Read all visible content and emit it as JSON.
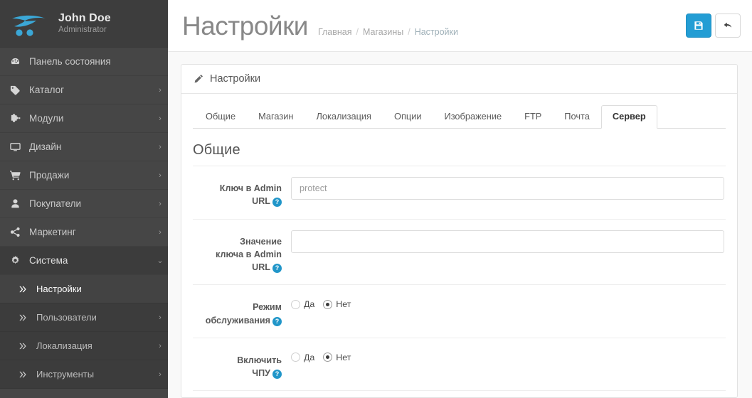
{
  "sidebar": {
    "brand": {
      "name": "John Doe",
      "role": "Administrator",
      "logo_icon": "opencart-logo-icon"
    },
    "items": [
      {
        "label": "Панель состояния",
        "icon": "dashboard-icon",
        "caret": "",
        "level": 0,
        "state": ""
      },
      {
        "label": "Каталог",
        "icon": "tag-icon",
        "caret": "›",
        "level": 0,
        "state": ""
      },
      {
        "label": "Модули",
        "icon": "puzzle-icon",
        "caret": "›",
        "level": 0,
        "state": ""
      },
      {
        "label": "Дизайн",
        "icon": "monitor-icon",
        "caret": "›",
        "level": 0,
        "state": ""
      },
      {
        "label": "Продажи",
        "icon": "cart-icon",
        "caret": "›",
        "level": 0,
        "state": ""
      },
      {
        "label": "Покупатели",
        "icon": "user-icon",
        "caret": "›",
        "level": 0,
        "state": ""
      },
      {
        "label": "Маркетинг",
        "icon": "share-icon",
        "caret": "›",
        "level": 0,
        "state": ""
      },
      {
        "label": "Система",
        "icon": "gear-icon",
        "caret": "⌄",
        "level": 0,
        "state": "open"
      },
      {
        "label": "Настройки",
        "icon": "chevron-double-right-icon",
        "caret": "",
        "level": 1,
        "state": "active"
      },
      {
        "label": "Пользователи",
        "icon": "chevron-double-right-icon",
        "caret": "›",
        "level": 1,
        "state": ""
      },
      {
        "label": "Локализация",
        "icon": "chevron-double-right-icon",
        "caret": "›",
        "level": 1,
        "state": ""
      },
      {
        "label": "Инструменты",
        "icon": "chevron-double-right-icon",
        "caret": "›",
        "level": 1,
        "state": ""
      }
    ]
  },
  "header": {
    "title": "Настройки",
    "breadcrumb": [
      {
        "label": "Главная",
        "last": false
      },
      {
        "label": "Магазины",
        "last": false
      },
      {
        "label": "Настройки",
        "last": true
      }
    ],
    "separator": "/",
    "actions": [
      {
        "name": "save-button",
        "icon": "floppy-save-icon",
        "style": "primary"
      },
      {
        "name": "back-button",
        "icon": "back-arrow-icon",
        "style": "default"
      }
    ]
  },
  "panel": {
    "heading": "Настройки",
    "heading_icon": "pencil-icon",
    "tabs": [
      {
        "label": "Общие",
        "active": false
      },
      {
        "label": "Магазин",
        "active": false
      },
      {
        "label": "Локализация",
        "active": false
      },
      {
        "label": "Опции",
        "active": false
      },
      {
        "label": "Изображение",
        "active": false
      },
      {
        "label": "FTP",
        "active": false
      },
      {
        "label": "Почта",
        "active": false
      },
      {
        "label": "Сервер",
        "active": true
      }
    ],
    "section_title": "Общие",
    "help_glyph": "?",
    "fields": [
      {
        "type": "text",
        "label_line1": "Ключ в Admin",
        "label_line2": "URL",
        "value": "",
        "placeholder": "protect",
        "name": "admin-url-key-input"
      },
      {
        "type": "text",
        "label_line1": "Значение",
        "label_line2": "ключа в Admin",
        "label_line3": "URL",
        "value": "",
        "placeholder": "",
        "name": "admin-url-key-value-input"
      },
      {
        "type": "radio",
        "label_line1": "Режим",
        "label_line2": "обслуживания",
        "name": "maintenance-mode-radio",
        "options": [
          {
            "label": "Да",
            "checked": false
          },
          {
            "label": "Нет",
            "checked": true
          }
        ]
      },
      {
        "type": "radio",
        "label_line1": "Включить",
        "label_line2": "ЧПУ",
        "name": "seo-urls-radio",
        "options": [
          {
            "label": "Да",
            "checked": false
          },
          {
            "label": "Нет",
            "checked": true
          }
        ]
      }
    ]
  },
  "colors": {
    "sidebar_bg": "#464646",
    "sidebar_brand_bg": "#3d3d3d",
    "accent": "#239dd4",
    "help_badge": "#2196c9",
    "logo_blue": "#3ba7d6",
    "page_bg": "#f9f9f9"
  }
}
